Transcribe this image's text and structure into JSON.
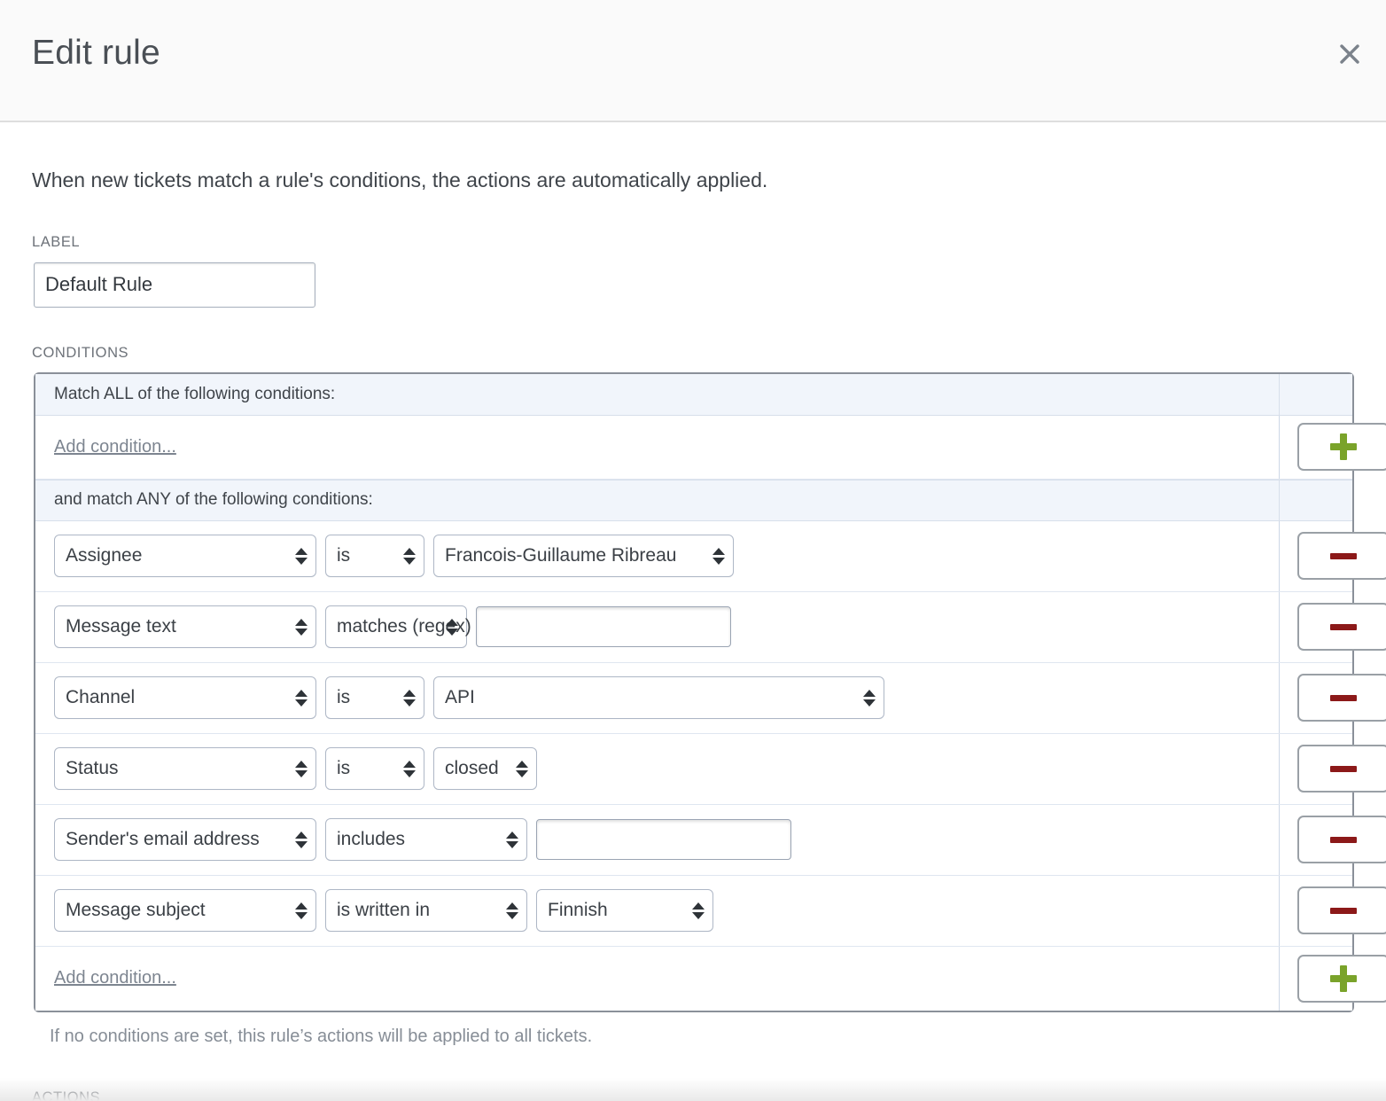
{
  "header": {
    "title": "Edit rule",
    "close_icon": "close-icon"
  },
  "intro": "When new tickets match a rule's conditions, the actions are automatically applied.",
  "label_section": {
    "label": "LABEL",
    "value": "Default Rule",
    "placeholder": ""
  },
  "conditions_section": {
    "label": "CONDITIONS",
    "all_group_header": "Match ALL of the following conditions:",
    "any_group_header": "and match ANY of the following conditions:",
    "add_condition_top": "Add condition...",
    "add_condition_bottom": "Add condition...",
    "add_button_icon": "plus-icon",
    "remove_button_icon": "minus-icon",
    "hint": "If no conditions are set, this rule’s actions will be applied to all tickets.",
    "rows": [
      {
        "field": "Assignee",
        "operator": "is",
        "value_type": "select",
        "value": "Francois-Guillaume Ribreau",
        "field_width": "w-field",
        "op_width": "w-op-s",
        "val_width": "w-val-l"
      },
      {
        "field": "Message text",
        "operator": "matches (regex)",
        "value_type": "text",
        "value": "",
        "placeholder": "",
        "field_width": "w-field",
        "op_width": "w-op-m",
        "val_width": ""
      },
      {
        "field": "Channel",
        "operator": "is",
        "value_type": "select",
        "value": "API",
        "field_width": "w-field",
        "op_width": "w-op-s",
        "val_width": "w-val-xl"
      },
      {
        "field": "Status",
        "operator": "is",
        "value_type": "select",
        "value": "closed",
        "field_width": "w-field",
        "op_width": "w-op-s",
        "val_width": "w-val-s"
      },
      {
        "field": "Sender's email address",
        "operator": "includes",
        "value_type": "text",
        "value": "",
        "placeholder": "",
        "field_width": "w-field",
        "op_width": "w-op-l",
        "val_width": ""
      },
      {
        "field": "Message subject",
        "operator": "is written in",
        "value_type": "select",
        "value": "Finnish",
        "field_width": "w-field",
        "op_width": "w-op-l",
        "val_width": "w-val-m"
      }
    ]
  },
  "actions_section": {
    "label": "ACTIONS"
  },
  "colors": {
    "plus": "#7aa32a",
    "minus": "#8c1919",
    "panel_border": "#8a9099",
    "group_header_bg": "#f1f5fb",
    "header_bg": "#fafafa"
  }
}
